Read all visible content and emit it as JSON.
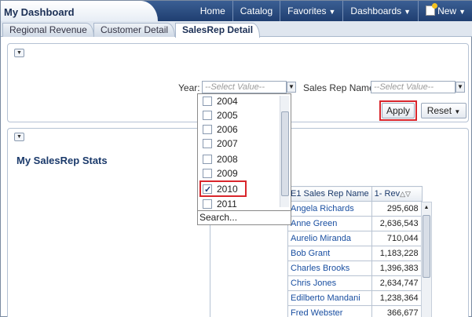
{
  "header": {
    "title": "My Dashboard",
    "nav": [
      {
        "label": "Home",
        "caret": ""
      },
      {
        "label": "Catalog",
        "caret": ""
      },
      {
        "label": "Favorites",
        "caret": "▼"
      },
      {
        "label": "Dashboards",
        "caret": "▼"
      },
      {
        "label": "New",
        "caret": "▼"
      }
    ]
  },
  "tabs": [
    {
      "label": "Regional Revenue"
    },
    {
      "label": "Customer Detail"
    },
    {
      "label": "SalesRep Detail",
      "active": true
    }
  ],
  "prompts": {
    "year_label": "Year:",
    "year_placeholder": "--Select Value--",
    "rep_label": "Sales Rep Name:",
    "rep_placeholder": "--Select Value--",
    "apply": "Apply",
    "reset": "Reset"
  },
  "year_dropdown": {
    "items": [
      {
        "label": "2004",
        "checked": false
      },
      {
        "label": "2005",
        "checked": false
      },
      {
        "label": "2006",
        "checked": false
      },
      {
        "label": "2007",
        "checked": false
      },
      {
        "label": "2008",
        "checked": false
      },
      {
        "label": "2009",
        "checked": false
      },
      {
        "label": "2010",
        "checked": true
      },
      {
        "label": "2011",
        "checked": false
      }
    ],
    "search": "Search..."
  },
  "stats": {
    "title": "My SalesRep Stats",
    "columns": [
      "E1 Sales Rep Name",
      "1- Rev"
    ],
    "rows": [
      [
        "Angela Richards",
        "295,608"
      ],
      [
        "Anne Green",
        "2,636,543"
      ],
      [
        "Aurelio Miranda",
        "710,044"
      ],
      [
        "Bob Grant",
        "1,183,228"
      ],
      [
        "Charles Brooks",
        "1,396,383"
      ],
      [
        "Chris Jones",
        "2,634,747"
      ],
      [
        "Edilberto Mandani",
        "1,238,364"
      ],
      [
        "Fred Webster",
        "366,677"
      ]
    ]
  },
  "colors": {
    "header_bg": "#1f3e70",
    "highlight": "#d9262c",
    "link": "#1a4fa1"
  }
}
